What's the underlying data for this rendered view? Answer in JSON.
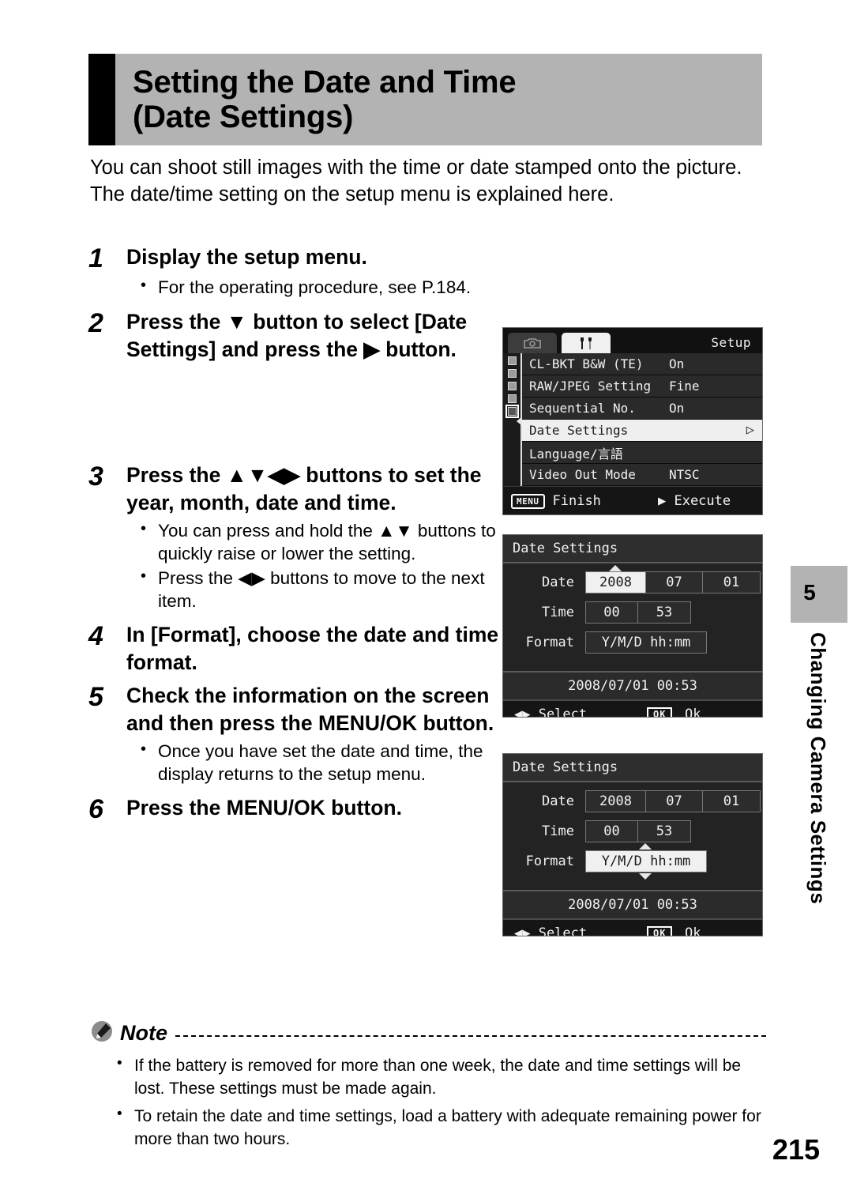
{
  "header": {
    "title_line1": "Setting the Date and Time",
    "title_line2": "(Date Settings)"
  },
  "intro": {
    "para1": "You can shoot still images with the time or date stamped onto the picture.",
    "para2": "The date/time setting on the setup menu is explained here."
  },
  "steps": [
    {
      "number": "1",
      "text": "Display the setup menu.",
      "bullets": [
        "For the operating procedure, see P.184."
      ]
    },
    {
      "number": "2",
      "text": "Press the ▼ button to select [Date Settings] and press the ▶ button.",
      "bullets": []
    },
    {
      "number": "3",
      "text": "Press the ▲▼◀▶ buttons to set the year, month, date and time.",
      "bullets": [
        "You can press and hold the ▲▼ buttons to quickly raise or lower the setting.",
        "Press the ◀▶ buttons to move to the next item."
      ]
    },
    {
      "number": "4",
      "text": "In [Format], choose the date and time format.",
      "bullets": []
    },
    {
      "number": "5",
      "text": "Check the information on the screen and then press the MENU/OK button.",
      "bullets": [
        "Once you have set the date and time, the display returns to the setup menu."
      ]
    },
    {
      "number": "6",
      "text": "Press the MENU/OK button.",
      "bullets": []
    }
  ],
  "lcd_setup": {
    "screen_label": "Setup",
    "tabs": [
      {
        "icon": "camera-icon",
        "state": "inactive"
      },
      {
        "icon": "wrench-screwdriver-icon",
        "state": "active"
      }
    ],
    "rail_dots": 5,
    "rail_current_index": 5,
    "rows": [
      {
        "label": "CL-BKT B&W (TE)",
        "value": "On",
        "selected": false,
        "caret": ""
      },
      {
        "label": "RAW/JPEG Setting",
        "value": "Fine",
        "selected": false,
        "caret": ""
      },
      {
        "label": "Sequential No.",
        "value": "On",
        "selected": false,
        "caret": ""
      },
      {
        "label": "Date Settings",
        "value": "",
        "selected": true,
        "caret": "▷"
      },
      {
        "label": "Language/言語",
        "value": "",
        "selected": false,
        "caret": ""
      },
      {
        "label": "Video Out Mode",
        "value": "NTSC",
        "selected": false,
        "caret": ""
      }
    ],
    "footer": {
      "menu_key": "MENU",
      "finish_label": "Finish",
      "execute_label": "▶ Execute"
    }
  },
  "lcd_date_year_selected": {
    "title": "Date Settings",
    "date_label": "Date",
    "date_year": "2008",
    "date_month": "07",
    "date_day": "01",
    "time_label": "Time",
    "time_hour": "00",
    "time_minute": "53",
    "format_label": "Format",
    "format_value": "Y/M/D hh:mm",
    "summary": "2008/07/01 00:53",
    "footer_select": "◀▶ Select",
    "footer_ok_key": "OK",
    "footer_ok_label": "Ok",
    "highlight": "year"
  },
  "lcd_date_format_selected": {
    "title": "Date Settings",
    "date_label": "Date",
    "date_year": "2008",
    "date_month": "07",
    "date_day": "01",
    "time_label": "Time",
    "time_hour": "00",
    "time_minute": "53",
    "format_label": "Format",
    "format_value": "Y/M/D hh:mm",
    "summary": "2008/07/01 00:53",
    "footer_select": "◀▶ Select",
    "footer_ok_key": "OK",
    "footer_ok_label": "Ok",
    "highlight": "format"
  },
  "chapter": {
    "number": "5",
    "title": "Changing Camera Settings"
  },
  "note": {
    "label": "Note",
    "items": [
      "If the battery is removed for more than one week, the date and time settings will be lost. These settings must be made again.",
      "To retain the date and time settings, load a battery with adequate remaining power for more than two hours."
    ]
  },
  "page_number": "215",
  "colors": {
    "header_band": "#b3b3b3",
    "header_bar": "#000000",
    "chapter_tab": "#b3b3b3",
    "lcd_bg": "#1b1b1b",
    "lcd_highlight": "#f0f0f0"
  }
}
